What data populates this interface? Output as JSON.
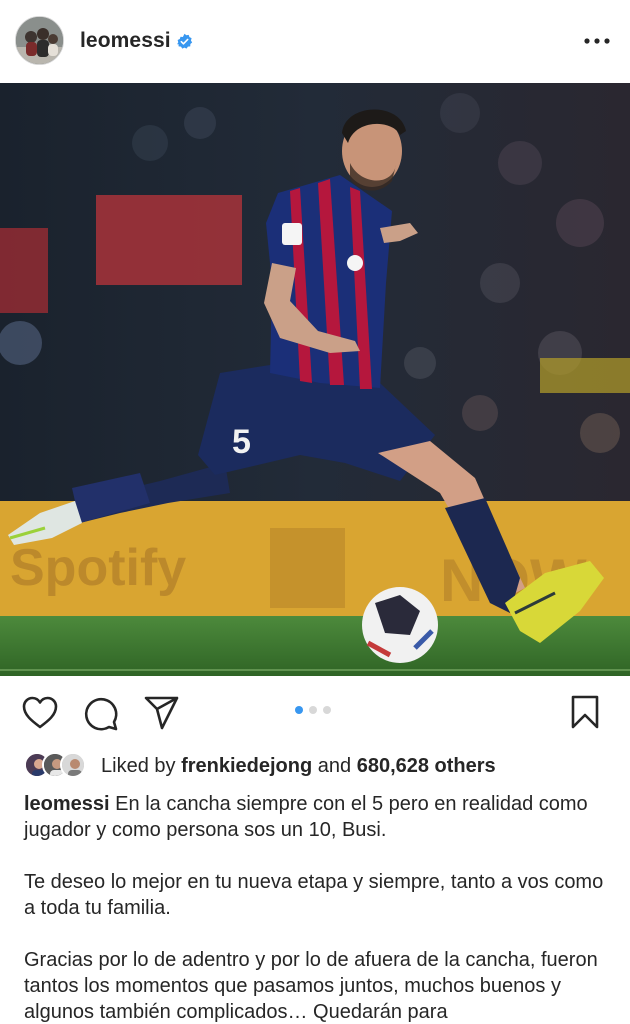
{
  "post": {
    "username": "leomessi",
    "verified_icon": "verified-badge-icon",
    "more_icon": "more-options-icon"
  },
  "photo": {
    "jersey_number": "5",
    "sponsor_text": "Spotify"
  },
  "actions": {
    "icons": [
      "heart-icon",
      "comment-icon",
      "share-icon",
      "bookmark-icon"
    ],
    "carousel_count": 3,
    "carousel_active": 0
  },
  "likes": {
    "prefix": "Liked by",
    "user": "frenkiedejong",
    "conjunction": "and",
    "others": "680,628 others"
  },
  "caption": {
    "username": "leomessi",
    "line1": "En la cancha siempre con el 5 pero en realidad como jugador y como persona sos un 10, Busi.",
    "line2": "Te deseo lo mejor en tu nueva etapa y siempre, tanto a vos como a toda tu familia.",
    "line3": "Gracias por lo de adentro y por lo de afuera de la cancha, fueron tantos los momentos que pasamos juntos, muchos buenos y algunos también complicados… Quedarán para"
  },
  "colors": {
    "accent": "#3897f0",
    "text": "#262626",
    "barca_blue": "#1e2f6e",
    "barca_red": "#b5173d",
    "pitch": "#3f7a33"
  }
}
